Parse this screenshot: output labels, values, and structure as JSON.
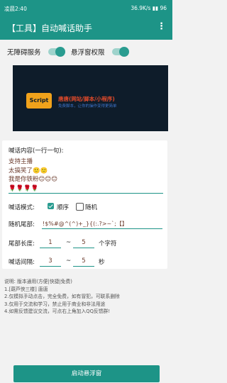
{
  "status_bar": {
    "time": "凌晨2:40",
    "network": "36.9K/s",
    "battery": "96"
  },
  "app": {
    "title": "【工具】自动喊话助手",
    "menu_icon": "more-vert-icon"
  },
  "toggles": [
    {
      "label": "无障碍服务",
      "on": true
    },
    {
      "label": "悬浮窗权限",
      "on": true
    }
  ],
  "banner": {
    "logo_text": "Script",
    "title": "唐唐(网站/脚本/小程序)",
    "subtitle": "免费脚本，让你的操作变得更简单"
  },
  "shout": {
    "label": "喊话内容(一行一句):",
    "lines": [
      "支持主播",
      "太搞笑了🙂🙂",
      "我是你铁粉😊😊😊",
      "🌹🌹🌹🌹"
    ]
  },
  "mode": {
    "label": "喊话模式:",
    "options": [
      "顺序",
      "随机"
    ],
    "selected": 0
  },
  "tail": {
    "label": "随机尾部:",
    "value": "!$%#@^(^)+_}{(:.?>~`;【】"
  },
  "tail_length": {
    "label": "尾部长度:",
    "min": "1",
    "sep": "~",
    "max": "5",
    "unit": "个字符"
  },
  "interval": {
    "label": "喊话间隔:",
    "min": "3",
    "sep": "~",
    "max": "5",
    "unit": "秒"
  },
  "notes": [
    "说明: 版本通用(方便|快捷|免费)",
    "1.[葫芦侠三楼] 唐唐",
    "2.仅模拟手动点击，完全免费，如有冒犯，可联系删除",
    "3.仅用于交流和学习，禁止用于商业和非法用途",
    "4.如需反馈建议交流，可点右上角加入QQ反馈群!"
  ],
  "start_button": "启动悬浮窗"
}
